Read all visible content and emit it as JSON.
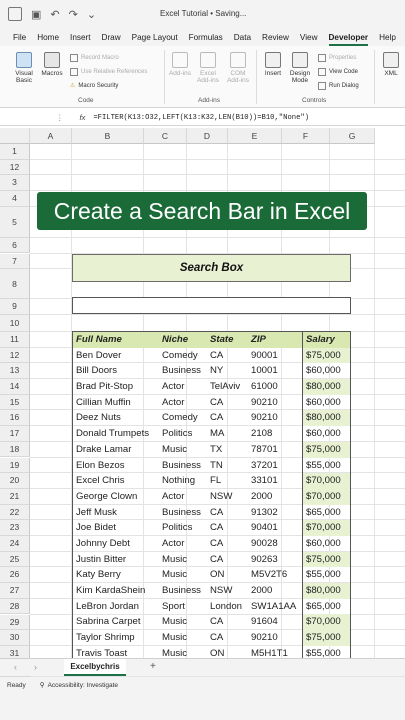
{
  "app": {
    "title": "Excel Tutorial • Saving..."
  },
  "menu": {
    "tabs": [
      "File",
      "Home",
      "Insert",
      "Draw",
      "Page Layout",
      "Formulas",
      "Data",
      "Review",
      "View",
      "Developer",
      "Help"
    ],
    "active": "Developer"
  },
  "ribbon": {
    "visual_basic": "Visual Basic",
    "macros": "Macros",
    "record_macro": "Record Macro",
    "relative_refs": "Use Relative References",
    "macro_security": "Macro Security",
    "group_code": "Code",
    "add_ins": "Add-ins",
    "excel_add_ins": "Excel Add-ins",
    "com_add_ins": "COM Add-ins",
    "group_add_ins": "Add-ins",
    "insert": "Insert",
    "design_mode": "Design Mode",
    "properties": "Properties",
    "view_code": "View Code",
    "run_dialog": "Run Dialog",
    "group_controls": "Controls",
    "xml": "XML"
  },
  "formula_bar": {
    "fx": "fx",
    "formula": "=FILTER(K13:O32,LEFT(K13:K32,LEN(B10))=B10,\"None\")"
  },
  "columns": [
    "A",
    "B",
    "C",
    "D",
    "E",
    "F",
    "G"
  ],
  "rows": [
    "1",
    "12",
    "3",
    "4",
    "5",
    "6",
    "7",
    "8",
    "9",
    "10",
    "11",
    "12",
    "13",
    "14",
    "15",
    "16",
    "17",
    "18",
    "19",
    "20",
    "21",
    "22",
    "23",
    "24",
    "25",
    "26",
    "27",
    "28",
    "29",
    "30",
    "31",
    "32"
  ],
  "banner": "Create a Search Bar in Excel",
  "search_box": {
    "label": "Search Box",
    "value": ""
  },
  "table": {
    "headers": [
      "Full Name",
      "Niche",
      "State",
      "ZIP",
      "Salary"
    ],
    "rows": [
      [
        "Ben Dover",
        "Comedy",
        "CA",
        "90001",
        "$75,000"
      ],
      [
        "Bill Doors",
        "Business",
        "NY",
        "10001",
        "$60,000"
      ],
      [
        "Brad Pit-Stop",
        "Actor",
        "TelAviv",
        "61000",
        "$80,000"
      ],
      [
        "Cillian Muffin",
        "Actor",
        "CA",
        "90210",
        "$60,000"
      ],
      [
        "Deez Nuts",
        "Comedy",
        "CA",
        "90210",
        "$80,000"
      ],
      [
        "Donald Trumpets",
        "Politics",
        "MA",
        "2108",
        "$60,000"
      ],
      [
        "Drake Lamar",
        "Music",
        "TX",
        "78701",
        "$75,000"
      ],
      [
        "Elon Bezos",
        "Business",
        "TN",
        "37201",
        "$55,000"
      ],
      [
        "Excel Chris",
        "Nothing",
        "FL",
        "33101",
        "$70,000"
      ],
      [
        "George Clown",
        "Actor",
        "NSW",
        "2000",
        "$70,000"
      ],
      [
        "Jeff Musk",
        "Business",
        "CA",
        "91302",
        "$65,000"
      ],
      [
        "Joe Bidet",
        "Politics",
        "CA",
        "90401",
        "$70,000"
      ],
      [
        "Johnny Debt",
        "Actor",
        "CA",
        "90028",
        "$60,000"
      ],
      [
        "Justin Bitter",
        "Music",
        "CA",
        "90263",
        "$75,000"
      ],
      [
        "Katy Berry",
        "Music",
        "ON",
        "M5V2T6",
        "$55,000"
      ],
      [
        "Kim KardaShein",
        "Business",
        "NSW",
        "2000",
        "$80,000"
      ],
      [
        "LeBron Jordan",
        "Sport",
        "London",
        "SW1A1AA",
        "$65,000"
      ],
      [
        "Sabrina Carpet",
        "Music",
        "CA",
        "91604",
        "$70,000"
      ],
      [
        "Taylor Shrimp",
        "Music",
        "CA",
        "90210",
        "$75,000"
      ],
      [
        "Travis Toast",
        "Music",
        "ON",
        "M5H1T1",
        "$55,000"
      ]
    ]
  },
  "sheets": {
    "active": "Excelbychris",
    "add": "+"
  },
  "status": {
    "ready": "Ready",
    "accessibility": "Accessibility: Investigate"
  },
  "colors": {
    "accent": "#1e7145",
    "banner_bg": "#1a6b38",
    "header_fill": "#d9e8b0",
    "highlight_fill": "#e9f1d3"
  }
}
